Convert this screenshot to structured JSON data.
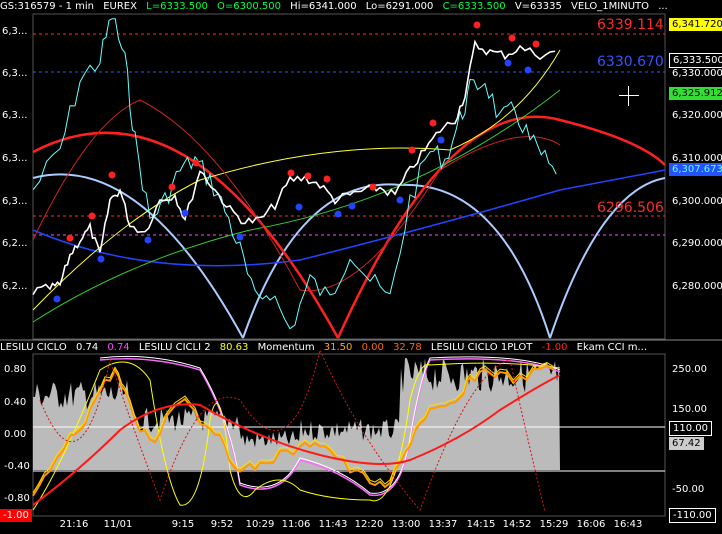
{
  "header": {
    "symbol": "GS:316579 - 1 min",
    "exchange": "EUREX",
    "last": "L=6333.500",
    "open": "O=6300.500",
    "high": "Hi=6341.000",
    "low": "Lo=6291.000",
    "close": "C=6333.500",
    "volume": "V=63335",
    "velo": "VELO_1MINUTO",
    "more": "..."
  },
  "price_axis": {
    "left_labels": [
      "6,3...",
      "6,3...",
      "6,3...",
      "6,3...",
      "6,3...",
      "6,2...",
      "6,2..."
    ],
    "right_labels": [
      "6,330.000",
      "6,320.000",
      "6,310.000",
      "6,300.000",
      "6,290.000",
      "6,280.000"
    ],
    "price_boxes": {
      "high_box": "6,341.720",
      "last_box": "6,333.500",
      "green_box": "6,325.912",
      "blue_box": "6,307.673"
    }
  },
  "levels": {
    "upper_red": "6339.114",
    "blue_level": "6330.670",
    "lower_red": "6296.506"
  },
  "lower_panel": {
    "indicators": [
      {
        "label": "LESILU CICLO",
        "value": "0.74",
        "value_color": "#ffffff"
      },
      {
        "label": "",
        "value": "0.74",
        "value_color": "#ff44ff"
      },
      {
        "label": "LESILU CICLI 2",
        "value": "80.63",
        "value_color": "#ffff00"
      },
      {
        "label": "Momentum",
        "value": "31.50",
        "value_color": "#ffaa00"
      },
      {
        "label": "",
        "value": "0.00",
        "value_color": "#ff6600"
      },
      {
        "label": "",
        "value": "32.78",
        "value_color": "#ff6600"
      },
      {
        "label": "LESILU CICLO 1PLOT",
        "value": "-1.00",
        "value_color": "#ff2222"
      },
      {
        "label": "Ekam CCI m...",
        "value": "",
        "value_color": "#ffffff"
      }
    ],
    "left_labels": [
      "0.80",
      "0.40",
      "0.00",
      "-0.40",
      "-0.80"
    ],
    "left_box": "-1.00",
    "right_labels": [
      "250.00",
      "150.00",
      "-50.00"
    ],
    "right_boxes": {
      "white_box": "110.00",
      "gray_box": "67.42",
      "bottom_box": "-110.00"
    }
  },
  "time_axis": [
    "21:16",
    "11/01",
    "9:15",
    "9:52",
    "10:29",
    "11:06",
    "11:43",
    "12:20",
    "13:00",
    "13:37",
    "14:15",
    "14:52",
    "15:29",
    "16:06",
    "16:43"
  ],
  "colors": {
    "price_line": "#ffffff",
    "velo_line": "#66ffff",
    "red_arc": "#ff2020",
    "blue_arc": "#aaccff",
    "up_dot": "#ff2020",
    "down_dot": "#2244ff",
    "grid": "#444444"
  }
}
